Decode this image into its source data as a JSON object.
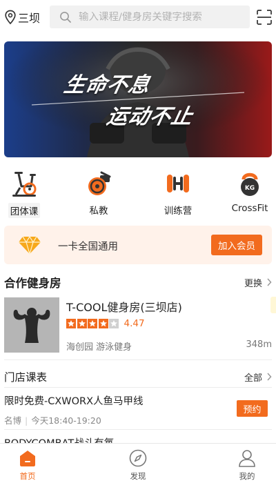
{
  "header": {
    "city": "三坝",
    "search_placeholder": "输入课程/健身房关键字搜索",
    "location_icon": "location-pin-icon",
    "scan_icon": "scan-icon"
  },
  "banner": {
    "line1": "生命不息",
    "line2": "运动不止"
  },
  "categories": [
    {
      "label": "团体课",
      "icon": "spin-bike-icon"
    },
    {
      "label": "私教",
      "icon": "whistle-icon"
    },
    {
      "label": "训练营",
      "icon": "dumbbell-icon"
    },
    {
      "label": "CrossFit",
      "icon": "kettlebell-icon",
      "icon_text": "KG"
    }
  ],
  "membership": {
    "text": "一卡全国通用",
    "button": "加入会员",
    "icon": "diamond-icon"
  },
  "partner_gyms": {
    "title": "合作健身房",
    "more": "更换",
    "gym": {
      "name": "T-COOL健身房(三坝店)",
      "rating": "4.47",
      "stars_filled": 4.5,
      "tags": "海创园 游泳健身",
      "distance": "348m",
      "image_icon": "bodybuilder-image"
    }
  },
  "classes": {
    "title": "门店课表",
    "more": "全部",
    "items": [
      {
        "title": "限时免费-CXWORX人鱼马甲线",
        "coach": "名博",
        "time": "今天18:40-19:20",
        "button": "预约"
      },
      {
        "title": "BODYCOMBAT战斗有氧"
      }
    ]
  },
  "bottom_nav": [
    {
      "label": "首页",
      "icon": "home-icon",
      "active": true
    },
    {
      "label": "发现",
      "icon": "compass-icon",
      "active": false
    },
    {
      "label": "我的",
      "icon": "user-icon",
      "active": false
    }
  ],
  "colors": {
    "accent": "#f26b1e",
    "member_bg": "#fff2ea",
    "search_bg": "#f1f1f1"
  }
}
